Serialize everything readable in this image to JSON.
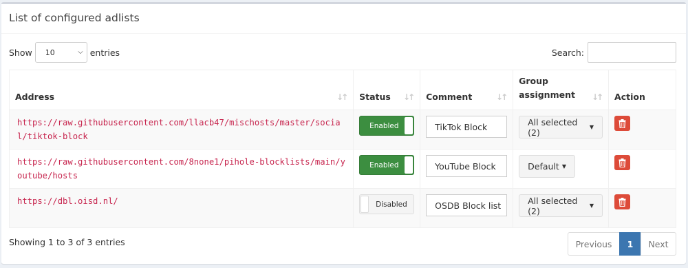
{
  "box": {
    "title": "List of configured adlists"
  },
  "controls": {
    "show_label": "Show",
    "entries_label": "entries",
    "length_value": "10",
    "search_label": "Search:",
    "search_value": ""
  },
  "table": {
    "headers": [
      "Address",
      "Status",
      "Comment",
      "Group assignment",
      "Action"
    ],
    "rows": [
      {
        "address": "https://raw.githubusercontent.com/llacb47/mischosts/master/social/tiktok-block",
        "status": "Enabled",
        "enabled": true,
        "comment": "TikTok Block",
        "group": "All selected (2)"
      },
      {
        "address": "https://raw.githubusercontent.com/8none1/pihole-blocklists/main/youtube/hosts",
        "status": "Enabled",
        "enabled": true,
        "comment": "YouTube Block",
        "group": "Default"
      },
      {
        "address": "https://dbl.oisd.nl/",
        "status": "Disabled",
        "enabled": false,
        "comment": "OSDB Block list",
        "group": "All selected (2)"
      }
    ]
  },
  "footer": {
    "info": "Showing 1 to 3 of 3 entries",
    "prev": "Previous",
    "current": "1",
    "next": "Next"
  },
  "colors": {
    "enabled": "#3c8e40",
    "delete": "#dd4b39",
    "pager_active": "#3c76b0",
    "address": "#c7254e"
  },
  "icons": {
    "delete": "trash-icon",
    "sort": "sort-icon",
    "dropdown": "caret-down-icon"
  }
}
